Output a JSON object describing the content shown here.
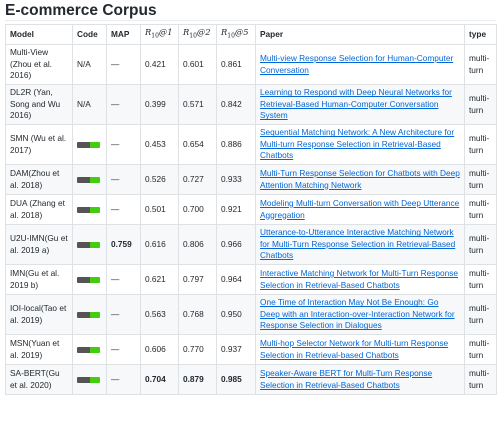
{
  "section_title": "E-commerce Corpus",
  "columns": {
    "model": "Model",
    "code": "Code",
    "map": "MAP",
    "metric_base": "R",
    "metric_sub": "10",
    "r1_suffix": "@1",
    "r2_suffix": "@2",
    "r5_suffix": "@5",
    "paper": "Paper",
    "type": "type"
  },
  "badge": {
    "icon": "official-code-badge-icon",
    "left_color": "#555555",
    "right_color": "#44cc11"
  },
  "rows": [
    {
      "model": "Multi-View (Zhou et al. 2016)",
      "code": "N/A",
      "map": "—",
      "r1": "0.421",
      "r2": "0.601",
      "r5": "0.861",
      "paper": "Multi-view Response Selection for Human-Computer Conversation",
      "type": "multi-turn"
    },
    {
      "model": "DL2R (Yan, Song and Wu 2016)",
      "code": "N/A",
      "map": "—",
      "r1": "0.399",
      "r2": "0.571",
      "r5": "0.842",
      "paper": "Learning to Respond with Deep Neural Networks for Retrieval-Based Human-Computer Conversation System",
      "type": "multi-turn"
    },
    {
      "model": "SMN (Wu et al. 2017)",
      "code": "",
      "map": "—",
      "r1": "0.453",
      "r2": "0.654",
      "r5": "0.886",
      "paper": "Sequential Matching Network: A New Architecture for Multi-turn Response Selection in Retrieval-Based Chatbots",
      "type": "multi-turn"
    },
    {
      "model": "DAM(Zhou et al. 2018)",
      "code": "",
      "map": "—",
      "r1": "0.526",
      "r2": "0.727",
      "r5": "0.933",
      "paper": "Multi-Turn Response Selection for Chatbots with Deep Attention Matching Network",
      "type": "multi-turn"
    },
    {
      "model": "DUA (Zhang et al. 2018)",
      "code": "",
      "map": "—",
      "r1": "0.501",
      "r2": "0.700",
      "r5": "0.921",
      "paper": "Modeling Multi-turn Conversation with Deep Utterance Aggregation",
      "type": "multi-turn"
    },
    {
      "model": "U2U-IMN(Gu et al. 2019 a)",
      "code": "",
      "map": "0.759",
      "r1": "0.616",
      "r2": "0.806",
      "r5": "0.966",
      "paper": "Utterance-to-Utterance Interactive Matching Network for Multi-Turn Response Selection in Retrieval-Based Chatbots",
      "type": "multi-turn"
    },
    {
      "model": "IMN(Gu et al. 2019 b)",
      "code": "",
      "map": "—",
      "r1": "0.621",
      "r2": "0.797",
      "r5": "0.964",
      "paper": "Interactive Matching Network for Multi-Turn Response Selection in Retrieval-Based Chatbots",
      "type": "multi-turn"
    },
    {
      "model": "IOI-local(Tao et al. 2019)",
      "code": "",
      "map": "—",
      "r1": "0.563",
      "r2": "0.768",
      "r5": "0.950",
      "paper": "One Time of Interaction May Not Be Enough: Go Deep with an Interaction-over-Interaction Network for Response Selection in Dialogues",
      "type": "multi-turn"
    },
    {
      "model": "MSN(Yuan et al. 2019)",
      "code": "",
      "map": "—",
      "r1": "0.606",
      "r2": "0.770",
      "r5": "0.937",
      "paper": "Multi-hop Selector Network for Multi-turn Response Selection in Retrieval-based Chatbots",
      "type": "multi-turn"
    },
    {
      "model": "SA-BERT(Gu et al. 2020)",
      "code": "",
      "map": "—",
      "r1": "0.704",
      "r2": "0.879",
      "r5": "0.985",
      "paper": "Speaker-Aware BERT for Multi-Turn Response Selection in Retrieval-Based Chatbots",
      "type": "multi-turn"
    }
  ]
}
